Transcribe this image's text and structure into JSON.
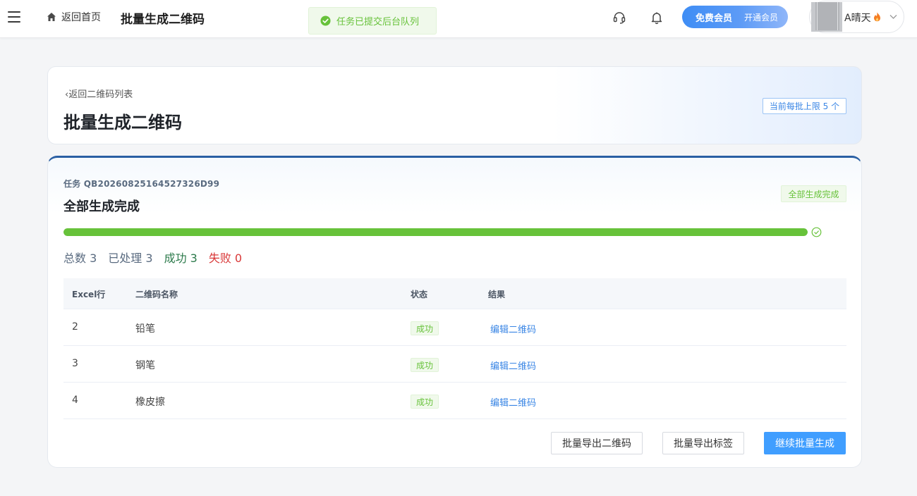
{
  "topbar": {
    "home_label": "返回首页",
    "title": "批量生成二维码",
    "toast": "任务已提交后台队列",
    "vip_label": "免费会员",
    "vip_action": "开通会员",
    "user_name": "A晴天",
    "icons": [
      "menu-icon",
      "home-icon",
      "success-icon",
      "headset-icon",
      "bell-icon",
      "fire-icon",
      "chevron-down-icon"
    ]
  },
  "header": {
    "back_label": "返回二维码列表",
    "title": "批量生成二维码",
    "limit_tag": "当前每批上限 5 个"
  },
  "task": {
    "id_label": "任务 QB20260825164527326D99",
    "status_title": "全部生成完成",
    "status_tag": "全部生成完成",
    "progress": 1.0,
    "stats": {
      "total": "总数 3",
      "processed": "已处理 3",
      "success": "成功 3",
      "failed": "失败 0"
    }
  },
  "table": {
    "columns": [
      "Excel行",
      "二维码名称",
      "状态",
      "结果"
    ],
    "rows": [
      {
        "row": "2",
        "name": "铅笔",
        "status": "成功",
        "result": "编辑二维码"
      },
      {
        "row": "3",
        "name": "钢笔",
        "status": "成功",
        "result": "编辑二维码"
      },
      {
        "row": "4",
        "name": "橡皮擦",
        "status": "成功",
        "result": "编辑二维码"
      }
    ]
  },
  "actions": {
    "export_qr": "批量导出二维码",
    "export_labels": "批量导出标签",
    "continue": "继续批量生成"
  },
  "colors": {
    "primary": "#409eff",
    "success": "#67c23a",
    "danger": "#d93838",
    "accent_border": "#2a5fa3"
  }
}
